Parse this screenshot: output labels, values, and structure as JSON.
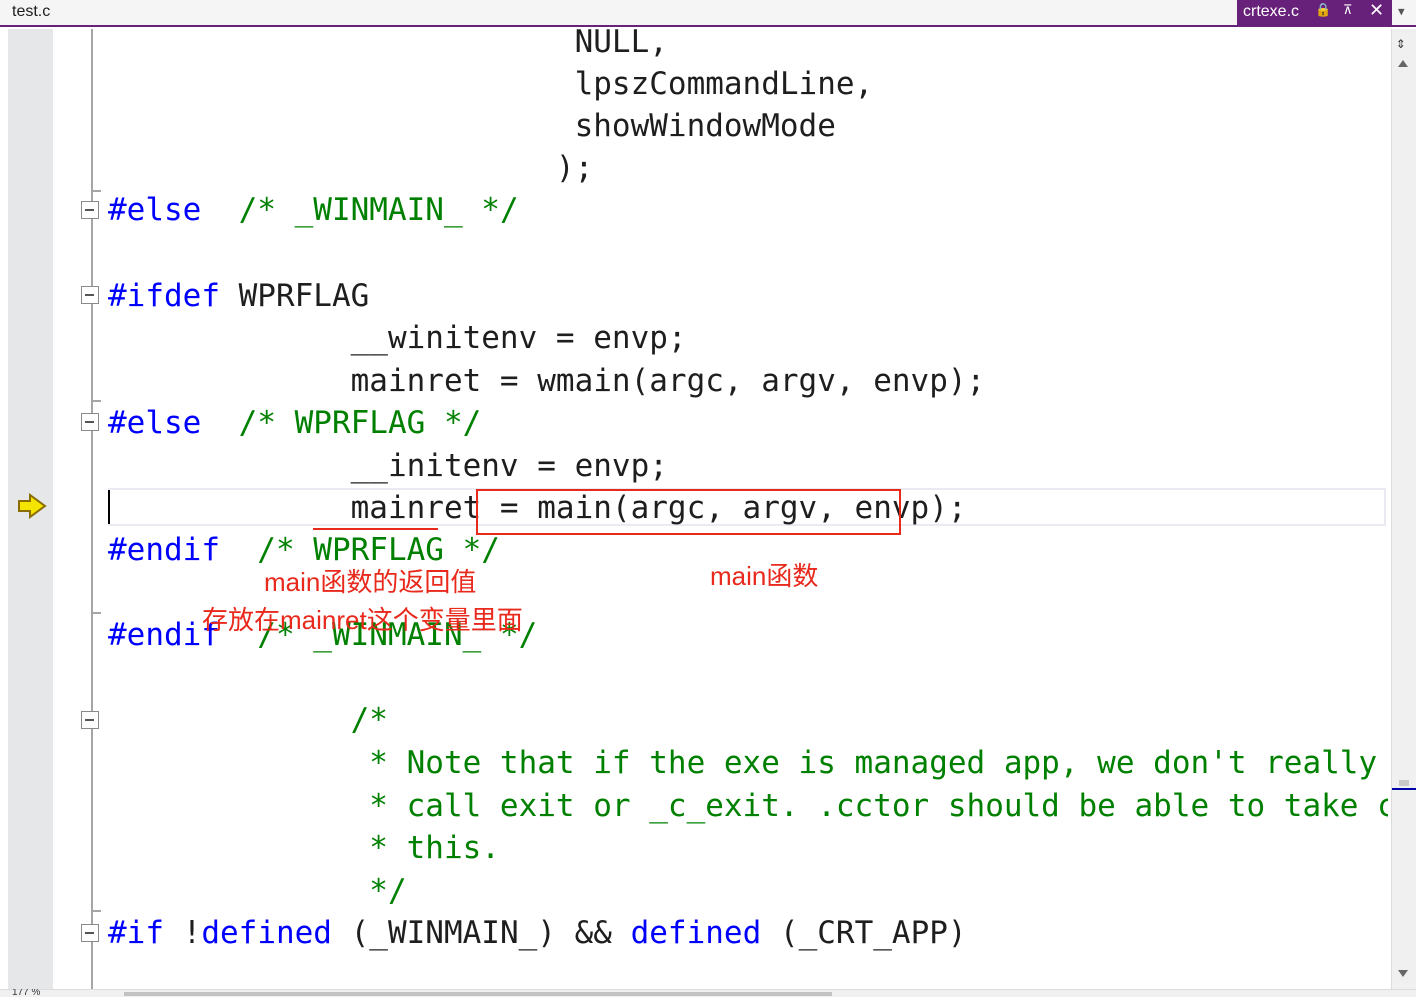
{
  "tabs": {
    "left_file": "test.c",
    "active_file": "crtexe.c",
    "pin_glyph": "🔒",
    "keep_glyph": "⊼",
    "close_glyph": "✕",
    "dropdown_glyph": "▼"
  },
  "editor": {
    "lines": [
      {
        "text": "                         NULL,",
        "cls": ""
      },
      {
        "text": "                         lpszCommandLine,",
        "cls": ""
      },
      {
        "text": "                         showWindowMode",
        "cls": ""
      },
      {
        "text": "                        );",
        "cls": ""
      },
      {
        "parts": [
          {
            "t": "#else",
            "c": "kw"
          },
          {
            "t": "  /* _WINMAIN_ */",
            "c": "cm"
          }
        ]
      },
      {
        "text": "",
        "cls": ""
      },
      {
        "parts": [
          {
            "t": "#ifdef",
            "c": "kw"
          },
          {
            "t": " WPRFLAG",
            "c": ""
          }
        ]
      },
      {
        "text": "             __winitenv = envp;",
        "cls": ""
      },
      {
        "text": "             mainret = wmain(argc, argv, envp);",
        "cls": ""
      },
      {
        "parts": [
          {
            "t": "#else",
            "c": "kw"
          },
          {
            "t": "  /* WPRFLAG */",
            "c": "cm"
          }
        ]
      },
      {
        "text": "             __initenv = envp;",
        "cls": ""
      },
      {
        "text": "             mainret = main(argc, argv, envp);",
        "cls": ""
      },
      {
        "parts": [
          {
            "t": "#endif",
            "c": "kw"
          },
          {
            "t": "  /* WPRFLAG */",
            "c": "cm"
          }
        ]
      },
      {
        "text": "",
        "cls": ""
      },
      {
        "parts": [
          {
            "t": "#endif",
            "c": "kw"
          },
          {
            "t": "  /* _WINMAIN_ */",
            "c": "cm"
          }
        ]
      },
      {
        "text": "",
        "cls": ""
      },
      {
        "text": "             /*",
        "cls": "cm"
      },
      {
        "text": "              * Note that if the exe is managed app, we don't really need to",
        "cls": "cm"
      },
      {
        "text": "              * call exit or _c_exit. .cctor should be able to take care of",
        "cls": "cm"
      },
      {
        "text": "              * this.",
        "cls": "cm"
      },
      {
        "text": "              */",
        "cls": "cm"
      },
      {
        "parts": [
          {
            "t": "#if",
            "c": "kw"
          },
          {
            "t": " !",
            "c": ""
          },
          {
            "t": "defined",
            "c": "kw"
          },
          {
            "t": " (_WINMAIN_) && ",
            "c": ""
          },
          {
            "t": "defined",
            "c": "kw"
          },
          {
            "t": " (_CRT_APP)",
            "c": ""
          }
        ]
      }
    ]
  },
  "annotations": {
    "return_value_line1": "main函数的返回值",
    "return_value_line2": "存放在mainret这个变量里面",
    "main_function": "main函数"
  },
  "status": {
    "zoom": "177 %"
  },
  "colors": {
    "keyword": "#0000ff",
    "comment": "#008000",
    "annotation": "#e8291c",
    "tab_active": "#68217a"
  }
}
